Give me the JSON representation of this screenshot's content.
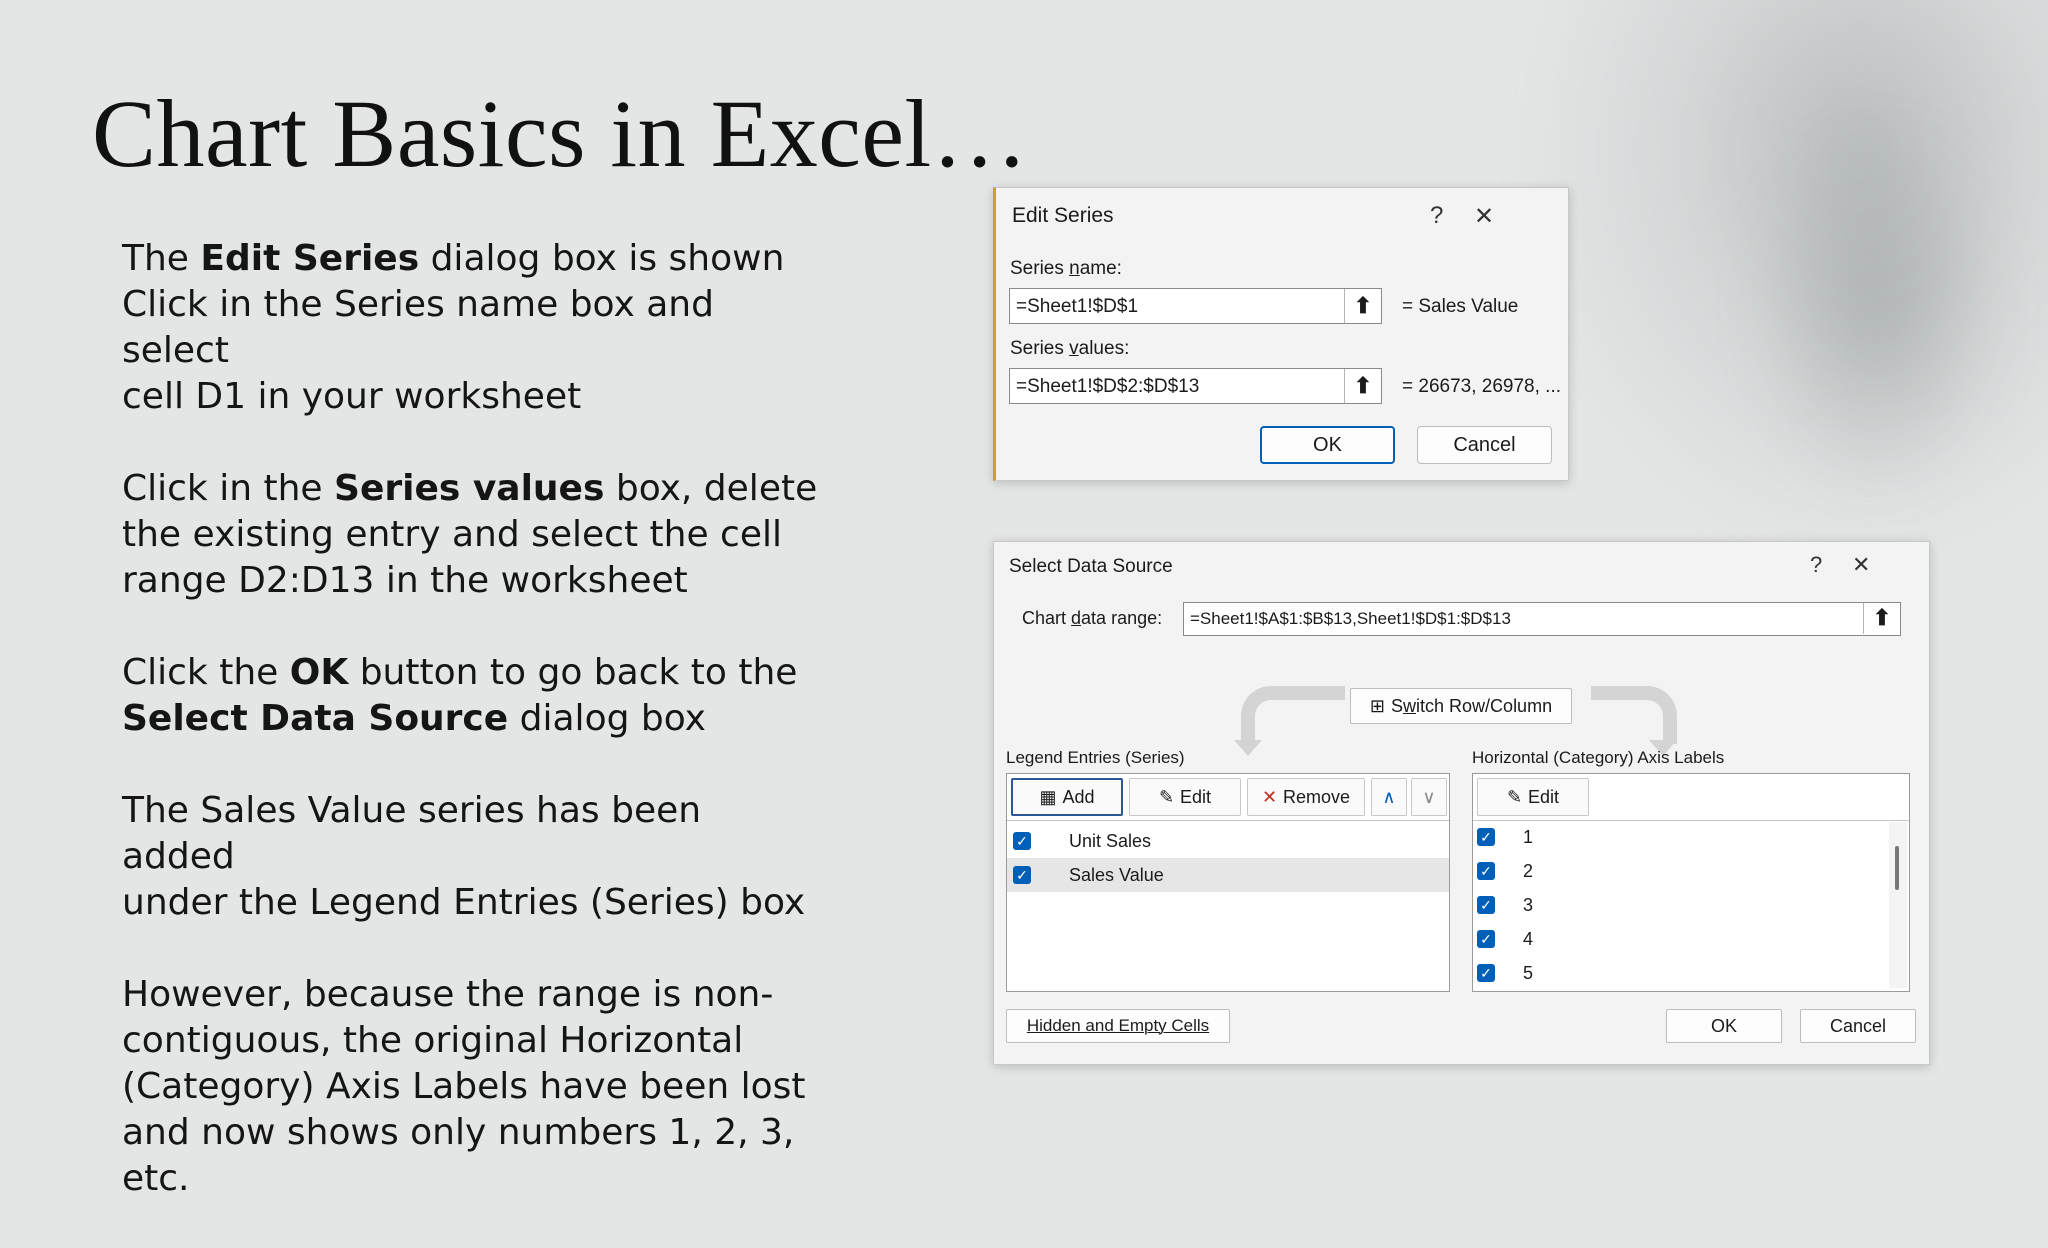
{
  "slide": {
    "title": "Chart Basics in Excel…",
    "paragraphs": [
      [
        {
          "t": "The "
        },
        {
          "t": "Edit Series",
          "b": true
        },
        {
          "t": " dialog box is shown\nClick in the Series name box and select\ncell D1 in your worksheet"
        }
      ],
      [
        {
          "t": "Click in the "
        },
        {
          "t": "Series values",
          "b": true
        },
        {
          "t": " box, delete\nthe existing entry and select the cell\nrange D2:D13 in the worksheet"
        }
      ],
      [
        {
          "t": "Click the "
        },
        {
          "t": "OK",
          "b": true
        },
        {
          "t": " button to go back to the\n"
        },
        {
          "t": "Select Data Source",
          "b": true
        },
        {
          "t": " dialog box"
        }
      ],
      [
        {
          "t": "The Sales Value series has been added\nunder the Legend Entries (Series) box"
        }
      ],
      [
        {
          "t": "However, because the range is non-\ncontiguous, the original Horizontal\n(Category) Axis Labels have been lost\nand now shows only numbers 1, 2, 3,\netc."
        }
      ]
    ]
  },
  "edit_series": {
    "title": "Edit Series",
    "help_glyph": "?",
    "close_glyph": "✕",
    "name_label_pre": "Series ",
    "name_label_u": "n",
    "name_label_post": "ame:",
    "name_value": "=Sheet1!$D$1",
    "name_result": "= Sales Value",
    "values_label_pre": "Series ",
    "values_label_u": "v",
    "values_label_post": "alues:",
    "values_value": "=Sheet1!$D$2:$D$13",
    "values_result": "= 26673, 26978, ...",
    "ok": "OK",
    "cancel": "Cancel",
    "collapse_icon": "⬆"
  },
  "select_source": {
    "title": "Select Data Source",
    "help_glyph": "?",
    "close_glyph": "✕",
    "range_label_pre": "Chart ",
    "range_label_u": "d",
    "range_label_post": "ata range:",
    "range_value": "=Sheet1!$A$1:$B$13,Sheet1!$D$1:$D$13",
    "switch_pre": "S",
    "switch_u": "w",
    "switch_post": "itch Row/Column",
    "legend_label": "Legend Entries (Series)",
    "axis_label": "Horizontal (Category) Axis Labels",
    "add": "Add",
    "edit": "Edit",
    "remove": "Remove",
    "axis_edit": "Edit",
    "series": [
      "Unit Sales",
      "Sales Value"
    ],
    "categories": [
      "1",
      "2",
      "3",
      "4",
      "5"
    ],
    "hidden_cells": "Hidden and Empty Cells",
    "ok": "OK",
    "cancel": "Cancel"
  }
}
